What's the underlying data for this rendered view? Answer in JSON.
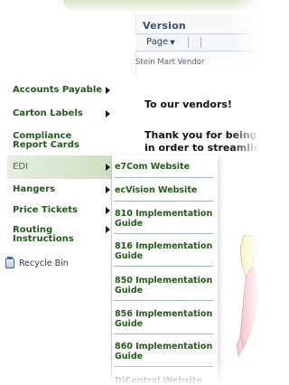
{
  "header": {
    "title": "Version",
    "page_menu_label": "Page",
    "breadcrumb": "Stein Mart Vendor"
  },
  "content": {
    "heading": "To our vendors!",
    "line1": "Thank you for being",
    "line2": "in order to streamlin"
  },
  "left_menu": {
    "items": [
      {
        "label": "Accounts Payable",
        "has_submenu": true
      },
      {
        "label": "Carton Labels",
        "has_submenu": true
      },
      {
        "label": "Compliance Report Cards",
        "has_submenu": false
      },
      {
        "label": "EDI",
        "has_submenu": true
      },
      {
        "label": "Hangers",
        "has_submenu": true
      },
      {
        "label": "Price Tickets",
        "has_submenu": true
      },
      {
        "label": "Routing Instructions",
        "has_submenu": true
      }
    ],
    "recycle_bin": "Recycle Bin"
  },
  "submenu": {
    "items": [
      "e7Com Website",
      "ecVision Website",
      "810 Implementation Guide",
      "816 Implementation Guide",
      "850 Implementation Guide",
      "856 Implementation Guide",
      "860 Implementation Guide",
      "DiCentral Website"
    ]
  },
  "colors": {
    "menu_text": "#235b1d",
    "highlight": "#cfdfc2",
    "separator": "#9fb8d6",
    "map_yellow": "#f6f0a6",
    "map_pink": "#f5a3b5"
  },
  "icons": {
    "recycle_bin": "recycle-bin-icon",
    "submenu_arrow": "chevron-right-icon"
  }
}
